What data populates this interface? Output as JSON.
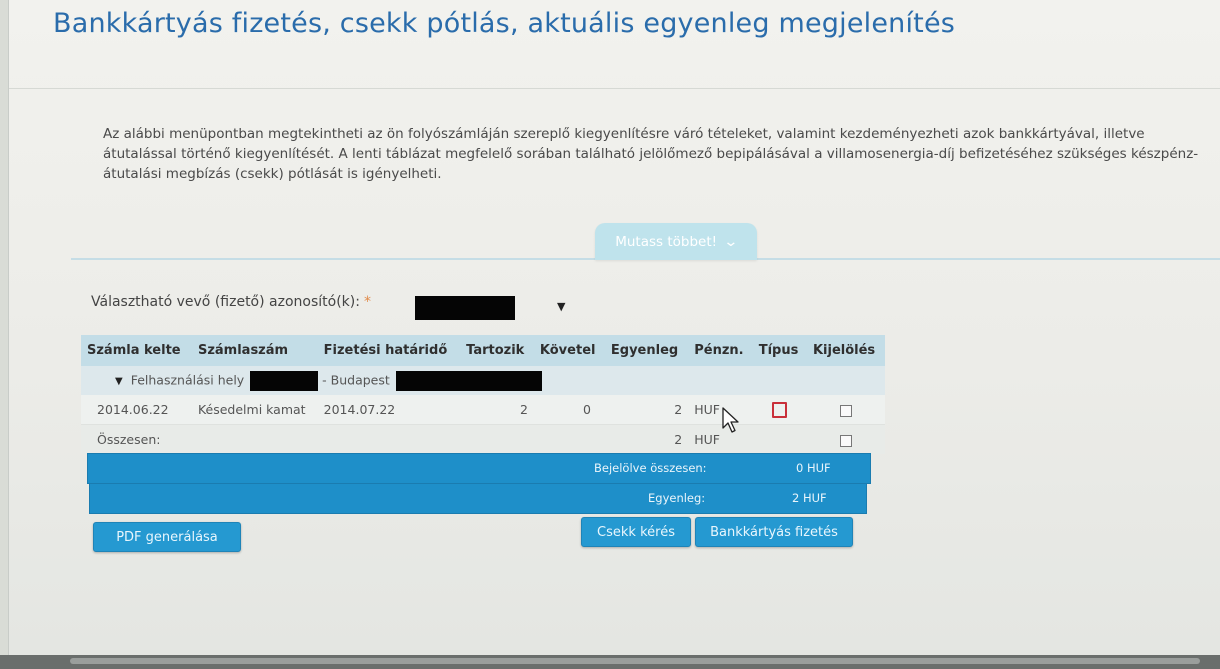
{
  "page": {
    "title": "Bankkártyás fizetés, csekk pótlás, aktuális egyenleg megjelenítés",
    "intro": "Az alábbi menüpontban megtekintheti az ön folyószámláján szereplő kiegyenlítésre váró tételeket, valamint kezdeményezheti azok bankkártyával, illetve átutalással történő kiegyenlítését. A lenti táblázat megfelelő sorában található jelölőmező bepipálásával a villamosenergia-díj befizetéséhez szükséges készpénz-átutalási megbízás (csekk) pótlását is igényelheti.",
    "show_more_label": "Mutass többet!"
  },
  "selector": {
    "label": "Választható vevő (fizető) azonosító(k):",
    "required_mark": "*"
  },
  "table": {
    "columns": [
      "Számla kelte",
      "Számlaszám",
      "Fizetési határidő",
      "Tartozik",
      "Követel",
      "Egyenleg",
      "Pénzn.",
      "Típus",
      "Kijelölés"
    ],
    "group": {
      "label": "Felhasználási hely",
      "city": "- Budapest"
    },
    "row": {
      "date": "2014.06.22",
      "number": "Késedelmi kamat",
      "due": "2014.07.22",
      "debit": "2",
      "credit": "0",
      "balance": "2",
      "currency": "HUF"
    },
    "total": {
      "label": "Összesen:",
      "balance": "2",
      "currency": "HUF"
    }
  },
  "summary": {
    "selected_label": "Bejelölve összesen:",
    "selected_value": "0 HUF",
    "balance_label": "Egyenleg:",
    "balance_value": "2 HUF"
  },
  "buttons": {
    "pdf": "PDF generálása",
    "check": "Csekk kérés",
    "card": "Bankkártyás fizetés"
  },
  "colors": {
    "title": "#2a6cab",
    "accent": "#1e8fc9",
    "header_bg": "#c3dde7",
    "type_icon": "#c9303a"
  }
}
